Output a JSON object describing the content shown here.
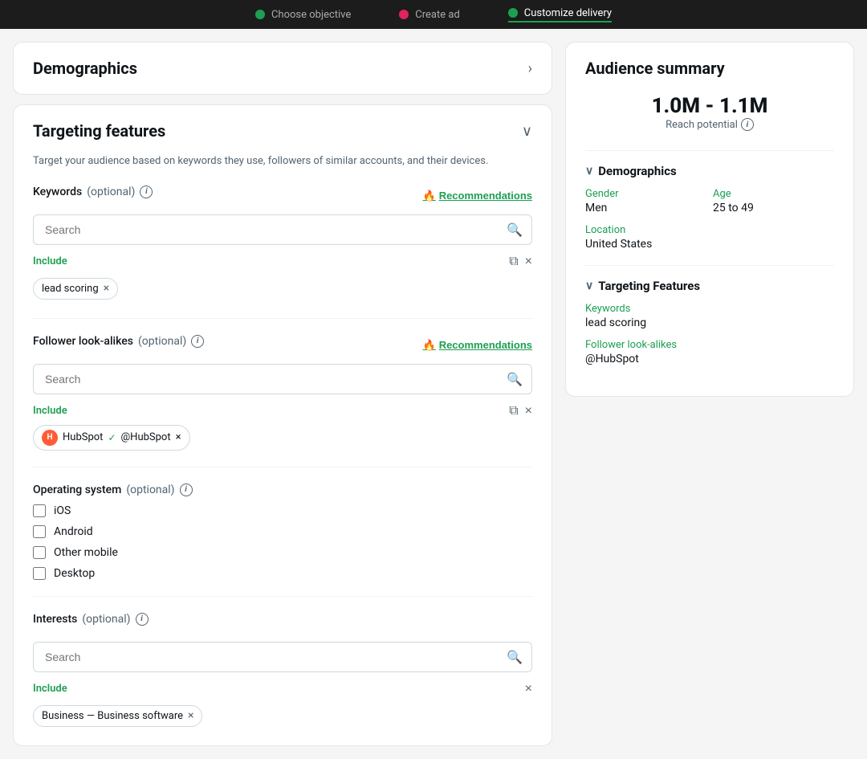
{
  "nav": {
    "steps": [
      {
        "id": "choose-objective",
        "label": "Choose objective",
        "dot": "green",
        "active": false
      },
      {
        "id": "create-ad",
        "label": "Create ad",
        "dot": "red",
        "active": false
      },
      {
        "id": "customize-delivery",
        "label": "Customize delivery",
        "dot": "green",
        "active": true
      }
    ]
  },
  "demographics": {
    "title": "Demographics",
    "chevron": "›"
  },
  "targeting": {
    "title": "Targeting features",
    "description": "Target your audience based on keywords they use, followers of similar accounts, and their devices.",
    "keywords": {
      "label": "Keywords",
      "optional": "(optional)",
      "placeholder": "Search",
      "recommendations_label": "Recommendations",
      "include_label": "Include",
      "tags": [
        {
          "id": "lead-scoring",
          "text": "lead scoring"
        }
      ]
    },
    "follower_lookalikes": {
      "label": "Follower look-alikes",
      "optional": "(optional)",
      "placeholder": "Search",
      "recommendations_label": "Recommendations",
      "include_label": "Include",
      "tags": [
        {
          "id": "hubspot",
          "name": "HubSpot",
          "handle": "@HubSpot",
          "verified": true
        }
      ]
    },
    "operating_system": {
      "label": "Operating system",
      "optional": "(optional)",
      "options": [
        {
          "id": "ios",
          "label": "iOS",
          "checked": false
        },
        {
          "id": "android",
          "label": "Android",
          "checked": false
        },
        {
          "id": "other-mobile",
          "label": "Other mobile",
          "checked": false
        },
        {
          "id": "desktop",
          "label": "Desktop",
          "checked": false
        }
      ]
    },
    "interests": {
      "label": "Interests",
      "optional": "(optional)",
      "placeholder": "Search",
      "include_label": "Include",
      "tags": [
        {
          "id": "business-software",
          "text": "Business — Business software"
        }
      ]
    }
  },
  "audience_summary": {
    "title": "Audience summary",
    "reach": "1.0M - 1.1M",
    "reach_label": "Reach potential",
    "sections": {
      "demographics": {
        "label": "Demographics",
        "fields": [
          {
            "id": "gender",
            "label": "Gender",
            "value": "Men"
          },
          {
            "id": "age",
            "label": "Age",
            "value": "25 to 49"
          },
          {
            "id": "location",
            "label": "Location",
            "value": "United States",
            "full": true
          }
        ]
      },
      "targeting_features": {
        "label": "Targeting Features",
        "fields": [
          {
            "id": "keywords",
            "label": "Keywords",
            "value": "lead scoring",
            "full": true
          },
          {
            "id": "follower-lookalikes",
            "label": "Follower look-alikes",
            "value": "@HubSpot",
            "full": true
          }
        ]
      }
    }
  },
  "icons": {
    "search": "🔍",
    "fire": "🔥",
    "chevron_right": "›",
    "chevron_down": "∨",
    "chevron_up": "∧",
    "close": "×",
    "copy": "⧉",
    "info": "i"
  }
}
